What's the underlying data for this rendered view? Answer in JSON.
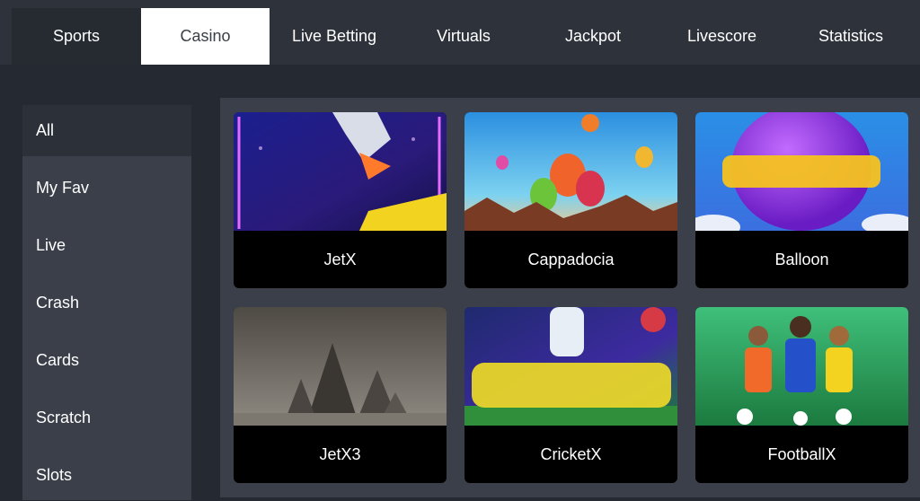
{
  "colors": {
    "page_bg": "#252a32",
    "nav_bg": "#2e333b",
    "active_tab_bg": "#ffffff",
    "active_tab_text": "#3a3f47",
    "panel_bg": "#3a3f4a",
    "card_caption_bg": "#000000"
  },
  "nav": {
    "tabs": [
      {
        "label": "Sports"
      },
      {
        "label": "Casino",
        "active": true
      },
      {
        "label": "Live Betting"
      },
      {
        "label": "Virtuals"
      },
      {
        "label": "Jackpot"
      },
      {
        "label": "Livescore"
      },
      {
        "label": "Statistics"
      }
    ]
  },
  "sidebar": {
    "items": [
      {
        "label": "All",
        "active": true
      },
      {
        "label": "My Fav"
      },
      {
        "label": "Live"
      },
      {
        "label": "Crash"
      },
      {
        "label": "Cards"
      },
      {
        "label": "Scratch"
      },
      {
        "label": "Slots"
      }
    ]
  },
  "games": [
    {
      "title": "JetX",
      "thumb_text": "JetX",
      "icon": "jetx-thumbnail"
    },
    {
      "title": "Cappadocia",
      "thumb_text": "CAPPADOCIA",
      "icon": "cappadocia-thumbnail"
    },
    {
      "title": "Balloon",
      "thumb_text": "BALLOON",
      "icon": "balloon-thumbnail"
    },
    {
      "title": "JetX3",
      "thumb_text": "JETX3",
      "icon": "jetx3-thumbnail"
    },
    {
      "title": "CricketX",
      "thumb_text": "CricketX",
      "icon": "cricketx-thumbnail"
    },
    {
      "title": "FootballX",
      "thumb_text": "FOOTBALLX",
      "icon": "footballx-thumbnail"
    }
  ]
}
